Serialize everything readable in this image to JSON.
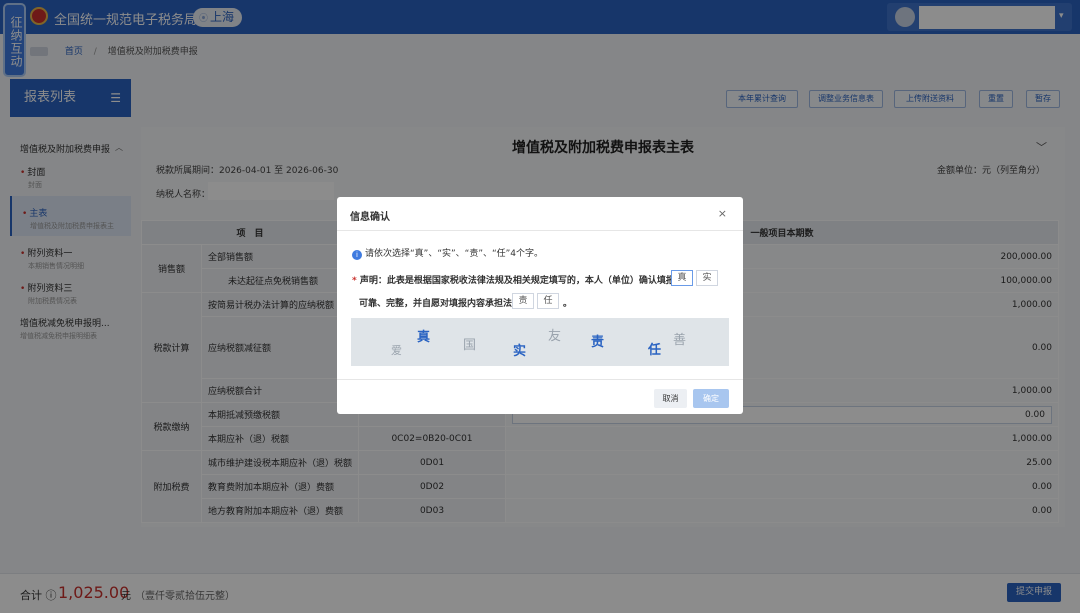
{
  "header": {
    "site_title": "全国统一规范电子税务局",
    "region": "上海",
    "side_tag": "征纳互动"
  },
  "breadcrumb": {
    "home": "首页",
    "sep": "/",
    "current": "增值税及附加税费申报"
  },
  "nav": {
    "title": "报表列表",
    "group": "增值税及附加税费申报",
    "items": [
      {
        "title": "封面",
        "sub": "封面",
        "required": true
      },
      {
        "title": "主表",
        "sub": "增值税及附加税费申报表主",
        "required": true,
        "active": true
      },
      {
        "title": "附列资料一",
        "sub": "本期销售情况明细",
        "required": true
      },
      {
        "title": "附列资料三",
        "sub": "附加税费情况表",
        "required": true
      },
      {
        "title": "增值税减免税申报明...",
        "sub": "增值税减免税申报明细表",
        "required": false
      }
    ]
  },
  "toolbar": {
    "btn_year_total": "本年累计查询",
    "btn_adjust": "调整业务信息表",
    "btn_upload": "上传附送资料",
    "btn_reset": "重置",
    "btn_save": "暂存"
  },
  "sheet": {
    "title": "增值税及附加税费申报表主表",
    "period": "税款所属期间：2026-04-01 至 2026-06-30",
    "unit": "金额单位：元（列至角分）",
    "payer_label": "纳税人名称：",
    "col_item": "项　目",
    "col_general": "一般项目本期数",
    "rows": [
      {
        "cat": "销售额",
        "label": "全部销售额",
        "code": "",
        "value": "200,000.00"
      },
      {
        "cat": "",
        "label": "未达起征点免税销售额",
        "code": "",
        "value": "100,000.00"
      },
      {
        "cat": "税款计算",
        "label": "按简易计税办法计算的应纳税额",
        "code": "",
        "value": "1,000.00"
      },
      {
        "cat": "",
        "label": "应纳税额减征额",
        "code": "",
        "value": "0.00"
      },
      {
        "cat": "",
        "label": "应纳税额合计",
        "code": "",
        "value": "1,000.00"
      },
      {
        "cat": "税款缴纳",
        "label": "本期抵减预缴税额",
        "code": "",
        "value": "0.00"
      },
      {
        "cat": "",
        "label": "本期应补（退）税额",
        "code": "0C02=0B20-0C01",
        "value": "1,000.00"
      },
      {
        "cat": "附加税费",
        "label": "城市维护建设税本期应补（退）税额",
        "code": "0D01",
        "value": "25.00"
      },
      {
        "cat": "",
        "label": "教育费附加本期应补（退）费额",
        "code": "0D02",
        "value": "0.00"
      },
      {
        "cat": "",
        "label": "地方教育附加本期应补（退）费额",
        "code": "0D03",
        "value": "0.00"
      }
    ]
  },
  "footer": {
    "total_label": "合计 ⓘ",
    "total_amount": "1,025.00",
    "total_unit": "元",
    "total_words": "（壹仟零贰拾伍元整）",
    "submit": "提交申报"
  },
  "dialog": {
    "title": "信息确认",
    "close": "×",
    "info": "请依次选择“真”、“实”、“责”、“任”4个字。",
    "decl_req": "*",
    "decl_line1": "声明：此表是根据国家税收法律法规及相关规定填写的，本人（单位）确认填报内容",
    "decl_line2": "可靠、完整，并自愿对填报内容承担法律",
    "decl_end": "。",
    "slot1": "真",
    "slot2": "实",
    "slot3": "责",
    "slot4": "任",
    "captcha_chars": [
      "爱",
      "真",
      "国",
      "实",
      "友",
      "责",
      "任",
      "善"
    ],
    "cancel": "取消",
    "confirm": "确定"
  }
}
